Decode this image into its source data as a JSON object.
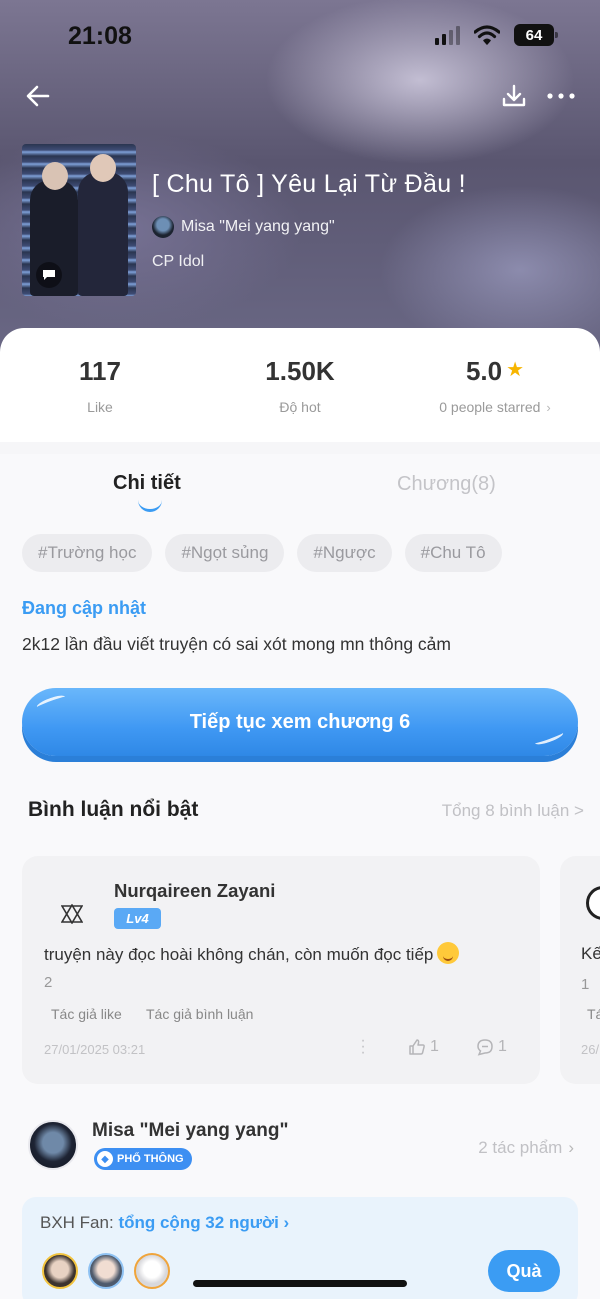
{
  "status_bar": {
    "time": "21:08",
    "battery": "64"
  },
  "header": {
    "title": "[ Chu Tô ] Yêu Lại Từ Đầu !",
    "author": "Misa \"Mei yang yang\"",
    "genre": "CP Idol"
  },
  "stats": {
    "likes": {
      "value": "117",
      "label": "Like"
    },
    "hot": {
      "value": "1.50K",
      "label": "Độ hot"
    },
    "rating": {
      "value": "5.0",
      "label": "0 people starred"
    }
  },
  "tabs": {
    "detail": "Chi tiết",
    "chapters": "Chương(8)"
  },
  "tags": [
    "#Trường học",
    "#Ngọt sủng",
    "#Ngược",
    "#Chu Tô"
  ],
  "status_label": "Đang cập nhật",
  "description": "2k12 lần đầu viết truyện có sai xót mong mn thông cảm",
  "continue_button": "Tiếp tục xem chương 6",
  "comments": {
    "title": "Bình luận nổi bật",
    "total": "Tổng 8 bình luận >",
    "items": [
      {
        "name": "Nurqaireen Zayani",
        "level": "Lv4",
        "text": "truyện này đọc hoài không chán, còn muốn đọc tiếp",
        "count": "2",
        "author_like": "Tác giả like",
        "author_comment": "Tác giả bình luận",
        "date": "27/01/2025 03:21",
        "likes": "1",
        "replies": "1"
      }
    ],
    "peek": {
      "text": "Kế",
      "count": "1",
      "tag": "Tá",
      "date": "26/"
    }
  },
  "author_section": {
    "name": "Misa \"Mei yang yang\"",
    "badge": "PHỔ THÔNG",
    "works": "2 tác phẩm"
  },
  "fan_ranking": {
    "label": "BXH Fan:",
    "total": "tổng cộng 32 người",
    "gift_button": "Quà"
  },
  "colors": {
    "accent": "#3b9cf3",
    "star": "#f7b500",
    "level": "#5aa9f5"
  }
}
